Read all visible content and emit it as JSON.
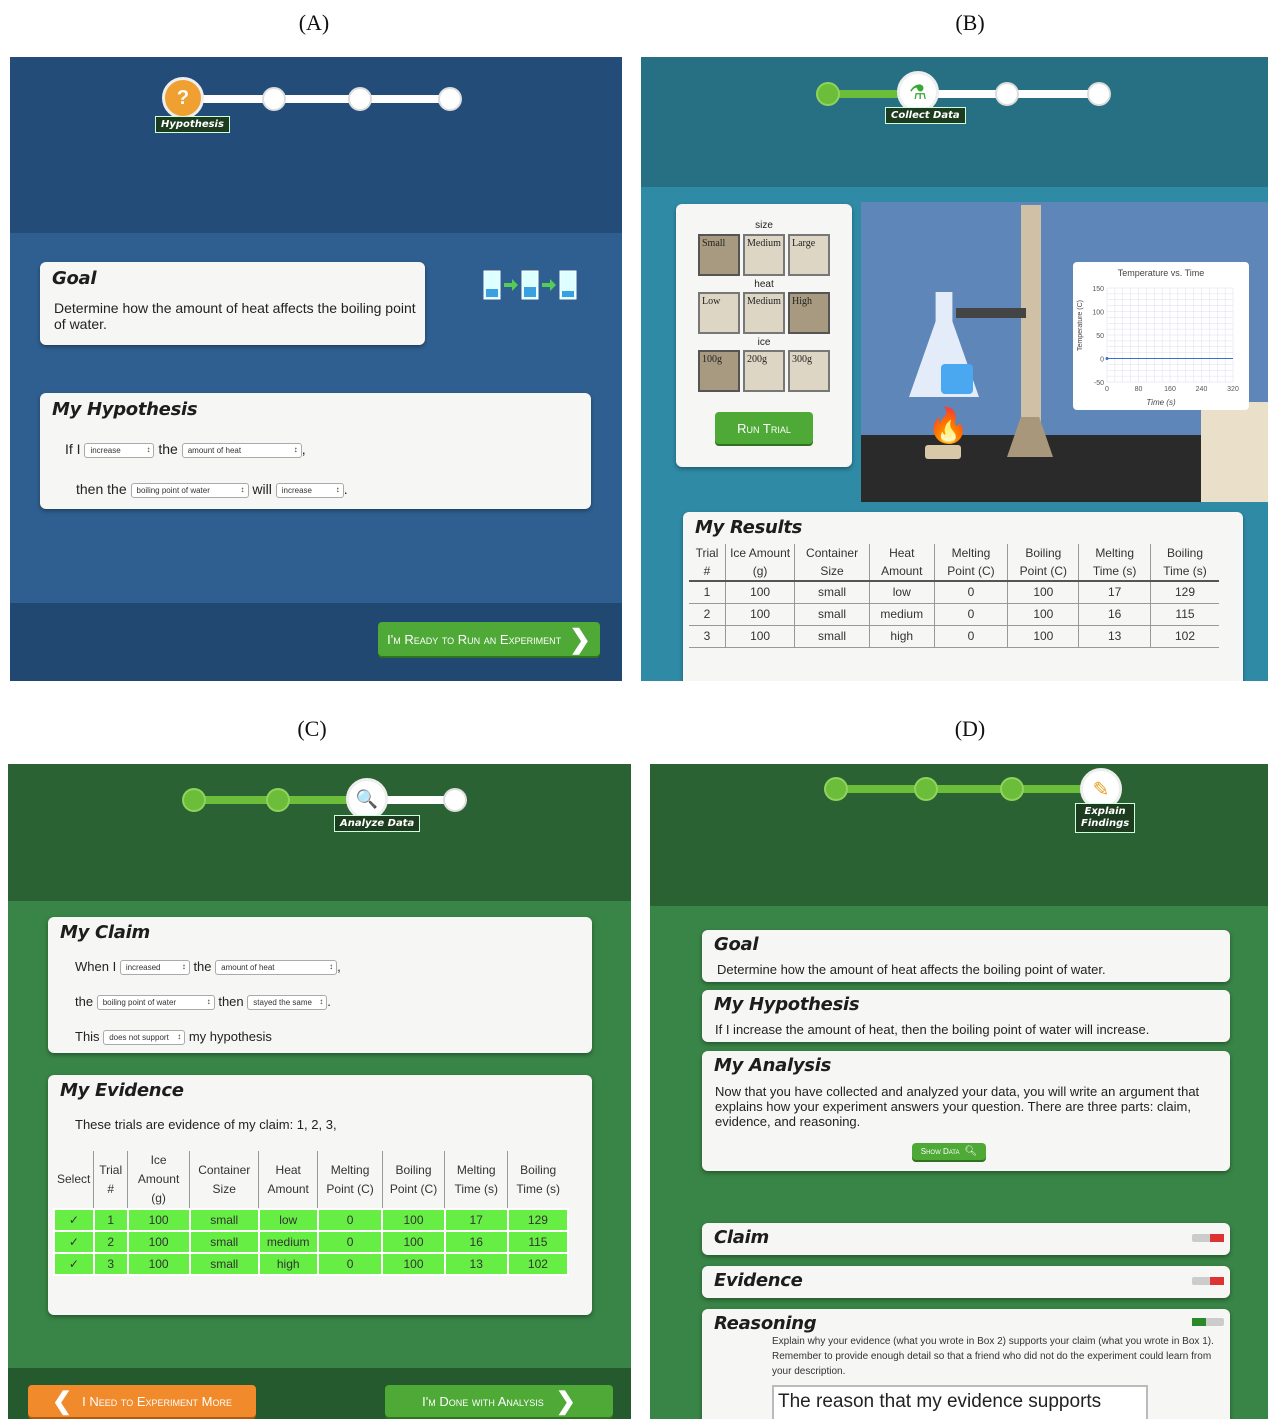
{
  "labels": {
    "a": "(A)",
    "b": "(B)",
    "c": "(C)",
    "d": "(D)"
  },
  "colors": {
    "blue_bg": "#2b5a86",
    "teal_bg": "#2f8aa6",
    "green_bg": "#2f6e3a",
    "button_green": "#4ea936",
    "button_orange": "#f08a2a",
    "row_green": "#66ee44"
  },
  "panelA": {
    "step_label": "Hypothesis",
    "goal": {
      "title": "Goal",
      "text": "Determine how the amount of heat affects the boiling point of water."
    },
    "hypothesis": {
      "title": "My Hypothesis",
      "if": "If I",
      "the": "the",
      "then_the": "then the",
      "will": "will",
      "sel1": "increase",
      "sel2": "amount of heat",
      "sel3": "boiling point of water",
      "sel4": "increase",
      "comma": ",",
      "period": "."
    },
    "ready_button": "I'm Ready to Run an Experiment"
  },
  "panelB": {
    "step_label": "Collect Data",
    "controls": {
      "size_label": "size",
      "sizes": [
        "Small",
        "Medium",
        "Large"
      ],
      "heat_label": "heat",
      "heats": [
        "Low",
        "Medium",
        "High"
      ],
      "ice_label": "ice",
      "ices": [
        "100g",
        "200g",
        "300g"
      ],
      "run_button": "Run Trial"
    },
    "chart": {
      "title": "Temperature vs. Time",
      "ylabel": "Temperature (C)",
      "xlabel": "Time (s)",
      "yticks": [
        "150",
        "100",
        "50",
        "0",
        "-50"
      ],
      "xticks": [
        "0",
        "80",
        "160",
        "240",
        "320"
      ]
    },
    "chart_data": {
      "type": "line",
      "title": "Temperature vs. Time",
      "xlabel": "Time (s)",
      "ylabel": "Temperature (C)",
      "xlim": [
        0,
        320
      ],
      "ylim": [
        -50,
        150
      ],
      "series": [
        {
          "values": [
            [
              0,
              0
            ],
            [
              320,
              0
            ]
          ]
        }
      ]
    },
    "results": {
      "title": "My Results",
      "headers": [
        "Trial #",
        "Ice Amount (g)",
        "Container Size",
        "Heat Amount",
        "Melting Point (C)",
        "Boiling Point (C)",
        "Melting Time (s)",
        "Boiling Time (s)"
      ],
      "rows": [
        [
          "1",
          "100",
          "small",
          "low",
          "0",
          "100",
          "17",
          "129"
        ],
        [
          "2",
          "100",
          "small",
          "medium",
          "0",
          "100",
          "16",
          "115"
        ],
        [
          "3",
          "100",
          "small",
          "high",
          "0",
          "100",
          "13",
          "102"
        ]
      ]
    }
  },
  "panelC": {
    "step_label": "Analyze Data",
    "claim": {
      "title": "My Claim",
      "when": "When I",
      "the": "the",
      "the2": "the",
      "then": "then",
      "this": "This",
      "my_hyp": "my hypothesis",
      "sel1": "increased",
      "sel2": "amount of heat",
      "sel3": "boiling point of water",
      "sel4": "stayed the same",
      "sel5": "does not support",
      "comma": ",",
      "period": "."
    },
    "evidence": {
      "title": "My Evidence",
      "intro": "These trials are evidence of my claim: 1, 2, 3,",
      "headers": [
        "Select",
        "Trial #",
        "Ice Amount (g)",
        "Container Size",
        "Heat Amount",
        "Melting Point (C)",
        "Boiling Point (C)",
        "Melting Time (s)",
        "Boiling Time (s)"
      ],
      "rows": [
        [
          "✓",
          "1",
          "100",
          "small",
          "low",
          "0",
          "100",
          "17",
          "129"
        ],
        [
          "✓",
          "2",
          "100",
          "small",
          "medium",
          "0",
          "100",
          "16",
          "115"
        ],
        [
          "✓",
          "3",
          "100",
          "small",
          "high",
          "0",
          "100",
          "13",
          "102"
        ]
      ]
    },
    "more_button": "I Need to Experiment More",
    "done_button": "I'm Done with Analysis"
  },
  "panelD": {
    "step_label_1": "Explain",
    "step_label_2": "Findings",
    "goal": {
      "title": "Goal",
      "text": "Determine how the amount of heat affects the boiling point of water."
    },
    "hypothesis": {
      "title": "My Hypothesis",
      "text": "If I increase the amount of heat, then the boiling point of water will increase."
    },
    "analysis": {
      "title": "My Analysis",
      "text": "Now that you have collected and analyzed your data, you will write an argument that explains how your experiment answers your question. There are three parts: claim, evidence, and reasoning.",
      "show_data": "Show Data"
    },
    "claim": "Claim",
    "evidence": "Evidence",
    "reasoning": {
      "title": "Reasoning",
      "text": "Explain why your evidence (what you wrote in Box 2) supports your claim (what you wrote in Box 1). Remember to provide enough detail so that a friend who did not do the experiment could learn from your description.",
      "input": "The reason that my evidence supports"
    }
  }
}
